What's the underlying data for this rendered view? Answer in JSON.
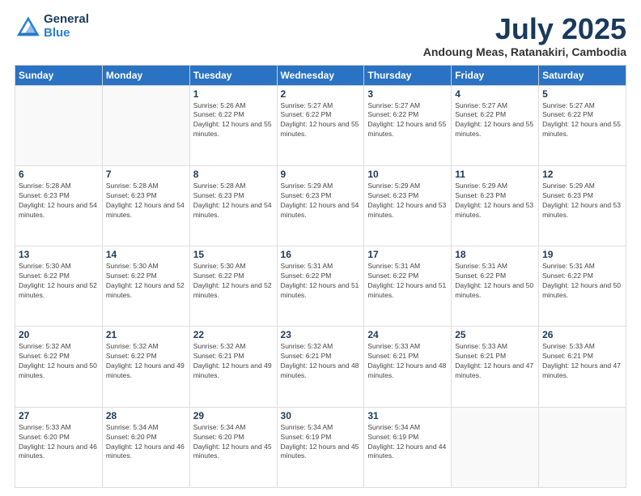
{
  "logo": {
    "general": "General",
    "blue": "Blue"
  },
  "header": {
    "month_year": "July 2025",
    "location": "Andoung Meas, Ratanakiri, Cambodia"
  },
  "weekdays": [
    "Sunday",
    "Monday",
    "Tuesday",
    "Wednesday",
    "Thursday",
    "Friday",
    "Saturday"
  ],
  "weeks": [
    [
      {
        "day": "",
        "info": ""
      },
      {
        "day": "",
        "info": ""
      },
      {
        "day": "1",
        "info": "Sunrise: 5:26 AM\nSunset: 6:22 PM\nDaylight: 12 hours and 55 minutes."
      },
      {
        "day": "2",
        "info": "Sunrise: 5:27 AM\nSunset: 6:22 PM\nDaylight: 12 hours and 55 minutes."
      },
      {
        "day": "3",
        "info": "Sunrise: 5:27 AM\nSunset: 6:22 PM\nDaylight: 12 hours and 55 minutes."
      },
      {
        "day": "4",
        "info": "Sunrise: 5:27 AM\nSunset: 6:22 PM\nDaylight: 12 hours and 55 minutes."
      },
      {
        "day": "5",
        "info": "Sunrise: 5:27 AM\nSunset: 6:22 PM\nDaylight: 12 hours and 55 minutes."
      }
    ],
    [
      {
        "day": "6",
        "info": "Sunrise: 5:28 AM\nSunset: 6:23 PM\nDaylight: 12 hours and 54 minutes."
      },
      {
        "day": "7",
        "info": "Sunrise: 5:28 AM\nSunset: 6:23 PM\nDaylight: 12 hours and 54 minutes."
      },
      {
        "day": "8",
        "info": "Sunrise: 5:28 AM\nSunset: 6:23 PM\nDaylight: 12 hours and 54 minutes."
      },
      {
        "day": "9",
        "info": "Sunrise: 5:29 AM\nSunset: 6:23 PM\nDaylight: 12 hours and 54 minutes."
      },
      {
        "day": "10",
        "info": "Sunrise: 5:29 AM\nSunset: 6:23 PM\nDaylight: 12 hours and 53 minutes."
      },
      {
        "day": "11",
        "info": "Sunrise: 5:29 AM\nSunset: 6:23 PM\nDaylight: 12 hours and 53 minutes."
      },
      {
        "day": "12",
        "info": "Sunrise: 5:29 AM\nSunset: 6:23 PM\nDaylight: 12 hours and 53 minutes."
      }
    ],
    [
      {
        "day": "13",
        "info": "Sunrise: 5:30 AM\nSunset: 6:22 PM\nDaylight: 12 hours and 52 minutes."
      },
      {
        "day": "14",
        "info": "Sunrise: 5:30 AM\nSunset: 6:22 PM\nDaylight: 12 hours and 52 minutes."
      },
      {
        "day": "15",
        "info": "Sunrise: 5:30 AM\nSunset: 6:22 PM\nDaylight: 12 hours and 52 minutes."
      },
      {
        "day": "16",
        "info": "Sunrise: 5:31 AM\nSunset: 6:22 PM\nDaylight: 12 hours and 51 minutes."
      },
      {
        "day": "17",
        "info": "Sunrise: 5:31 AM\nSunset: 6:22 PM\nDaylight: 12 hours and 51 minutes."
      },
      {
        "day": "18",
        "info": "Sunrise: 5:31 AM\nSunset: 6:22 PM\nDaylight: 12 hours and 50 minutes."
      },
      {
        "day": "19",
        "info": "Sunrise: 5:31 AM\nSunset: 6:22 PM\nDaylight: 12 hours and 50 minutes."
      }
    ],
    [
      {
        "day": "20",
        "info": "Sunrise: 5:32 AM\nSunset: 6:22 PM\nDaylight: 12 hours and 50 minutes."
      },
      {
        "day": "21",
        "info": "Sunrise: 5:32 AM\nSunset: 6:22 PM\nDaylight: 12 hours and 49 minutes."
      },
      {
        "day": "22",
        "info": "Sunrise: 5:32 AM\nSunset: 6:21 PM\nDaylight: 12 hours and 49 minutes."
      },
      {
        "day": "23",
        "info": "Sunrise: 5:32 AM\nSunset: 6:21 PM\nDaylight: 12 hours and 48 minutes."
      },
      {
        "day": "24",
        "info": "Sunrise: 5:33 AM\nSunset: 6:21 PM\nDaylight: 12 hours and 48 minutes."
      },
      {
        "day": "25",
        "info": "Sunrise: 5:33 AM\nSunset: 6:21 PM\nDaylight: 12 hours and 47 minutes."
      },
      {
        "day": "26",
        "info": "Sunrise: 5:33 AM\nSunset: 6:21 PM\nDaylight: 12 hours and 47 minutes."
      }
    ],
    [
      {
        "day": "27",
        "info": "Sunrise: 5:33 AM\nSunset: 6:20 PM\nDaylight: 12 hours and 46 minutes."
      },
      {
        "day": "28",
        "info": "Sunrise: 5:34 AM\nSunset: 6:20 PM\nDaylight: 12 hours and 46 minutes."
      },
      {
        "day": "29",
        "info": "Sunrise: 5:34 AM\nSunset: 6:20 PM\nDaylight: 12 hours and 45 minutes."
      },
      {
        "day": "30",
        "info": "Sunrise: 5:34 AM\nSunset: 6:19 PM\nDaylight: 12 hours and 45 minutes."
      },
      {
        "day": "31",
        "info": "Sunrise: 5:34 AM\nSunset: 6:19 PM\nDaylight: 12 hours and 44 minutes."
      },
      {
        "day": "",
        "info": ""
      },
      {
        "day": "",
        "info": ""
      }
    ]
  ]
}
